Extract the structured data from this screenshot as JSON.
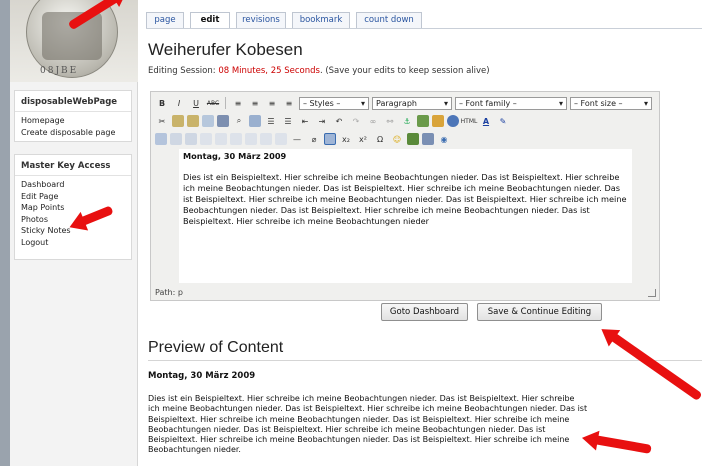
{
  "brand": {
    "rim_text": "08JBE"
  },
  "sidebar": {
    "site_box": {
      "title": "disposableWebPage",
      "links": [
        "Homepage",
        "Create disposable page"
      ]
    },
    "master_box": {
      "title": "Master Key Access",
      "links": [
        "Dashboard",
        "Edit Page",
        "Map Points",
        "Photos",
        "Sticky Notes",
        "Logout"
      ]
    }
  },
  "tabs": [
    "page",
    "edit",
    "revisions",
    "bookmark",
    "count down"
  ],
  "active_tab": "edit",
  "page_title": "Weiherufer Kobesen",
  "session": {
    "prefix": "Editing Session:",
    "time": "08 Minutes, 25 Seconds",
    "suffix": ". (Save your edits to keep session alive)"
  },
  "editor": {
    "toolbar": {
      "styles": "– Styles –",
      "format": "Paragraph",
      "font_family": "– Font family –",
      "font_size": "– Font size –",
      "buttons_row1": [
        "B",
        "I",
        "U",
        "ABC"
      ]
    },
    "content_heading": "Montag, 30 März 2009",
    "content_body": "Dies ist ein Beispieltext. Hier schreibe ich meine Beobachtungen nieder. Das ist Beispieltext. Hier schreibe ich meine Beobachtungen nieder. Das ist Beispieltext. Hier schreibe ich meine Beobachtungen nieder. Das ist Beispieltext. Hier schreibe ich meine Beobachtungen nieder. Das ist Beispieltext. Hier schreibe ich meine Beobachtungen nieder. Das ist Beispieltext. Hier schreibe ich meine Beobachtungen nieder. Das ist Beispieltext. Hier schreibe ich meine Beobachtungen nieder",
    "path": "Path: p"
  },
  "buttons": {
    "goto_dashboard": "Goto Dashboard",
    "save_continue": "Save & Continue Editing"
  },
  "preview": {
    "title": "Preview of Content",
    "heading": "Montag, 30 März 2009",
    "body": "Dies ist ein Beispieltext. Hier schreibe ich meine Beobachtungen nieder. Das ist Beispieltext. Hier schreibe ich meine Beobachtungen nieder. Das ist Beispieltext. Hier schreibe ich meine Beobachtungen nieder. Das ist Beispieltext. Hier schreibe ich meine Beobachtungen nieder. Das ist Beispieltext. Hier schreibe ich meine Beobachtungen nieder. Das ist Beispieltext. Hier schreibe ich meine Beobachtungen nieder. Das ist Beispieltext. Hier schreibe ich meine Beobachtungen nieder. Das ist Beispieltext. Hier schreibe ich meine Beobachtungen nieder."
  },
  "colors": {
    "accent_red": "#e81010",
    "session_red": "#cc0000",
    "link_blue": "#2a55a0"
  }
}
